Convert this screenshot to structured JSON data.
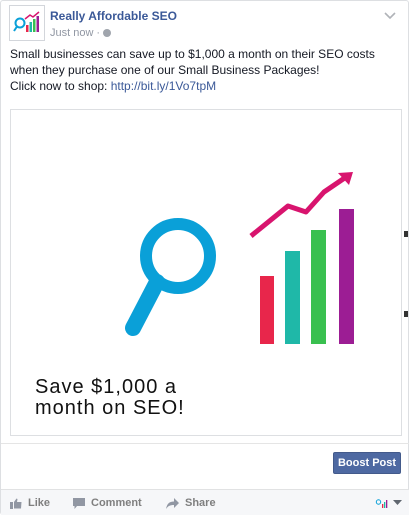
{
  "post": {
    "page_name": "Really Affordable SEO",
    "time": "Just now",
    "separator": "·",
    "privacy_icon": "globe-icon",
    "text_line1": "Small businesses can save up to $1,000 a month on their SEO costs",
    "text_line2": "when they purchase one of our Small Business Packages!",
    "text_line3_prefix": "Click now to shop: ",
    "link": "http://bit.ly/1Vo7tpM",
    "image": {
      "caption_line1": "Save $1,000 a",
      "caption_line2": "month on SEO!",
      "icons": [
        "magnifying-glass-icon",
        "bar-chart-icon",
        "trend-arrow-icon"
      ],
      "colors": {
        "magnifier": "#0aa0d8",
        "bar_red": "#e8264b",
        "bar_teal": "#1fb8a8",
        "bar_green": "#39c04f",
        "bar_purple": "#9c1d94",
        "arrow": "#d8146e"
      }
    }
  },
  "boost": {
    "label": "Boost Post",
    "color": "#4e69a2"
  },
  "actions": {
    "like": "Like",
    "comment": "Comment",
    "share": "Share"
  }
}
